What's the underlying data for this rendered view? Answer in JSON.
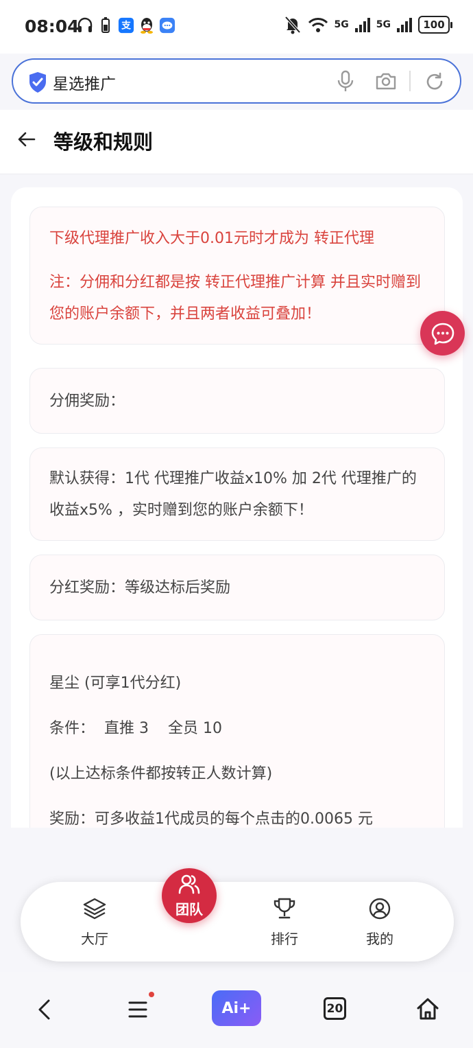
{
  "status_bar": {
    "time": "08:04",
    "network_1": "5G",
    "network_2": "5G",
    "battery": "100"
  },
  "search": {
    "query": "星选推广"
  },
  "header": {
    "title": "等级和规则"
  },
  "notice": {
    "line1": "下级代理推广收入大于0.01元时才成为 转正代理",
    "line2": "注：分佣和分红都是按 转正代理推广计算 并且实时赠到您的账户余额下，并且两者收益可叠加！"
  },
  "sections": {
    "commission_title": "分佣奖励：",
    "commission_detail": "默认获得：1代 代理推广收益x10% 加 2代 代理推广的收益x5% ，实时赠到您的账户余额下！",
    "dividend_title": "分红奖励：等级达标后奖励"
  },
  "level": {
    "name": "星尘 (可享1代分红)",
    "condition": "条件：  直推 3    全员 10",
    "note": "(以上达标条件都按转正人数计算)",
    "reward": "奖励：可多收益1代成员的每个点击的0.0065 元"
  },
  "tabbar": {
    "hall": "大厅",
    "team": "团队",
    "rank": "排行",
    "mine": "我的"
  },
  "browser_nav": {
    "ai": "Ai+",
    "tab_count": "20"
  },
  "colors": {
    "accent_red": "#d42b42",
    "notice_text": "#d9433d",
    "search_border": "#4a72d8"
  }
}
